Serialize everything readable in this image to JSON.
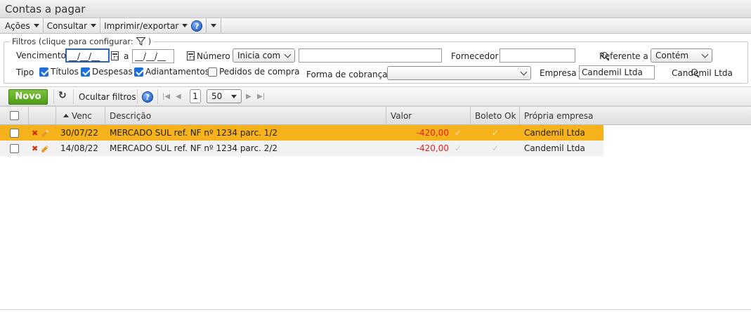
{
  "window": {
    "title": "Contas a pagar"
  },
  "menubar": {
    "items": [
      {
        "label": "Ações"
      },
      {
        "label": "Consultar"
      },
      {
        "label": "Imprimir/exportar"
      }
    ],
    "help": "?"
  },
  "filters": {
    "legend": "Filtros (clique para configurar:",
    "legend_close": ")",
    "vencimento_label": "Vencimento",
    "date_from": "__/__/__",
    "between": "a",
    "date_to": "__/__/__",
    "numero_label": "Número",
    "numero_mode": "Inicia com",
    "numero_value": "",
    "fornecedor_label": "Fornecedor",
    "fornecedor_value": "",
    "referente_label": "Referente a",
    "referente_mode": "Contém",
    "tipo_label": "Tipo",
    "tipos": [
      {
        "label": "Títulos",
        "checked": true
      },
      {
        "label": "Despesas",
        "checked": true
      },
      {
        "label": "Adiantamentos",
        "checked": true
      },
      {
        "label": "Pedidos de compra",
        "checked": false
      }
    ],
    "forma_label": "Forma de cobrança",
    "forma_value": "",
    "empresa_label": "Empresa",
    "empresa_value": "Candemil Ltda",
    "empresa_display": "Candemil Ltda"
  },
  "toolbar": {
    "novo": "Novo",
    "ocultar_filtros": "Ocultar filtros",
    "help": "?",
    "page": "1",
    "page_size": "50"
  },
  "grid": {
    "columns": {
      "venc": "Venc",
      "descricao": "Descrição",
      "valor": "Valor",
      "boleto_ok": "Boleto Ok",
      "propria_empresa": "Própria empresa"
    },
    "rows": [
      {
        "venc": "30/07/22",
        "descricao": "MERCADO SUL ref. NF nº 1234 parc. 1/2",
        "valor": "-420,00",
        "empresa": "Candemil Ltda",
        "selected": true
      },
      {
        "venc": "14/08/22",
        "descricao": "MERCADO SUL ref. NF nº 1234 parc. 2/2",
        "valor": "-420,00",
        "empresa": "Candemil Ltda",
        "selected": false
      }
    ]
  },
  "colors": {
    "selected_row": "#f6b21b",
    "novo_button": "#5ea826",
    "negative_value": "#e02020",
    "focus_border": "#2a66c6"
  }
}
